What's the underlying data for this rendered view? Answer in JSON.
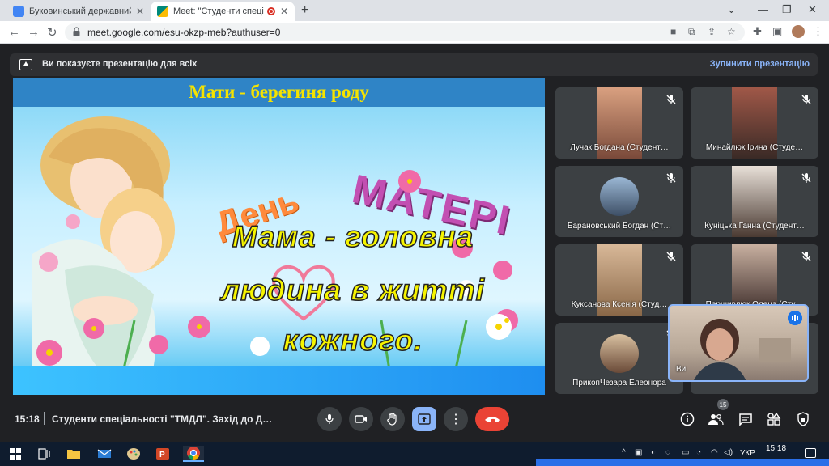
{
  "browser": {
    "tabs": [
      {
        "title": "Буковинський державний меди",
        "favicon_color": "#4285f4"
      },
      {
        "title": "Meet: \"Студенти спеціальності",
        "favicon_color": "#00897b"
      }
    ],
    "url": "meet.google.com/esu-okzp-meb?authuser=0"
  },
  "meet": {
    "banner_message": "Ви показуєте презентацію для всіх",
    "stop_presenting": "Зупинити презентацію",
    "slide": {
      "title": "Мати - берегиня роду",
      "day_word": "День",
      "mother_word": "МАТЕРІ",
      "lines": [
        "Мама - головна",
        "людина в житті",
        "кожного."
      ]
    },
    "participants": [
      {
        "name": "Лучак Богдана (Студент…",
        "muted": true,
        "type": "video"
      },
      {
        "name": "Минайлюк Ірина (Студе…",
        "muted": true,
        "type": "video"
      },
      {
        "name": "Барановський Богдан (Ст…",
        "muted": true,
        "type": "avatar"
      },
      {
        "name": "Куніцька Ганна (Студент…",
        "muted": true,
        "type": "video"
      },
      {
        "name": "Куксанова Ксенія (Студ…",
        "muted": true,
        "type": "video"
      },
      {
        "name": "Паршивлюк Олена (Сту…",
        "muted": true,
        "type": "video"
      },
      {
        "name": "ПрикопЧезара Елеонора",
        "muted": true,
        "type": "avatar"
      }
    ],
    "self_name": "Ви",
    "time": "15:18",
    "meeting_title": "Студенти спеціальності \"ТМДЛ\". Захід до Д…",
    "participant_count": "15"
  },
  "taskbar": {
    "language": "УКР",
    "clock": "15:18"
  }
}
